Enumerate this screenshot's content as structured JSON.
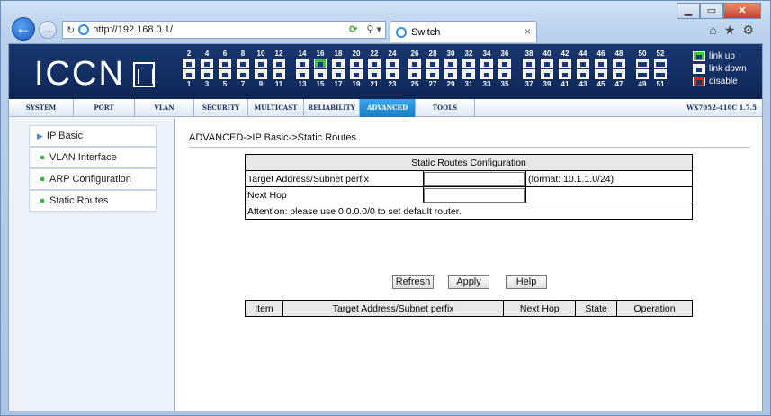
{
  "browser": {
    "url": "http://192.168.0.1/",
    "tab_title": "Switch",
    "tab_close": "×",
    "window_controls": [
      "▁",
      "▭",
      "✕"
    ],
    "toolbar_icons": [
      "home-icon",
      "star-icon",
      "gear-icon"
    ]
  },
  "header": {
    "logo": "ICCN",
    "legend": [
      {
        "label": "link up",
        "state": "up",
        "color": "#3cc43c"
      },
      {
        "label": "link down",
        "state": "down",
        "color": "#f0f0f0"
      },
      {
        "label": "disable",
        "state": "disabled",
        "color": "#dd2222"
      }
    ],
    "port_top_labels": [
      "2",
      "4",
      "6",
      "8",
      "10",
      "12",
      "14",
      "16",
      "18",
      "20",
      "22",
      "24",
      "26",
      "28",
      "30",
      "32",
      "34",
      "36",
      "38",
      "40",
      "42",
      "44",
      "46",
      "48",
      "50",
      "52"
    ],
    "port_bottom_labels": [
      "1",
      "3",
      "5",
      "7",
      "9",
      "11",
      "13",
      "15",
      "17",
      "19",
      "21",
      "23",
      "25",
      "27",
      "29",
      "31",
      "33",
      "35",
      "37",
      "39",
      "41",
      "43",
      "45",
      "47",
      "49",
      "51"
    ],
    "ports_up": [
      "16"
    ]
  },
  "menu": {
    "items": [
      "SYSTEM",
      "PORT",
      "VLAN",
      "SECURITY",
      "MULTICAST",
      "RELIABILITY",
      "ADVANCED",
      "TOOLS"
    ],
    "active": "ADVANCED",
    "version": "WX7052-410C 1.7.5"
  },
  "sidebar": {
    "items": [
      {
        "label": "IP Basic",
        "type": "section"
      },
      {
        "label": "VLAN Interface",
        "type": "sub"
      },
      {
        "label": "ARP Configuration",
        "type": "sub"
      },
      {
        "label": "Static Routes",
        "type": "sub"
      }
    ]
  },
  "main": {
    "breadcrumb": "ADVANCED->IP Basic->Static Routes",
    "config": {
      "title": "Static Routes Configuration",
      "target_label": "Target Address/Subnet perfix",
      "target_value": "",
      "format_hint": "(format: 10.1.1.0/24)",
      "nexthop_label": "Next Hop",
      "nexthop_value": "",
      "attention": "Attention: please use 0.0.0.0/0 to set default router."
    },
    "buttons": {
      "refresh": "Refresh",
      "apply": "Apply",
      "help": "Help"
    },
    "list_headers": [
      "Item",
      "Target Address/Subnet perfix",
      "Next Hop",
      "State",
      "Operation"
    ],
    "list_rows": []
  }
}
